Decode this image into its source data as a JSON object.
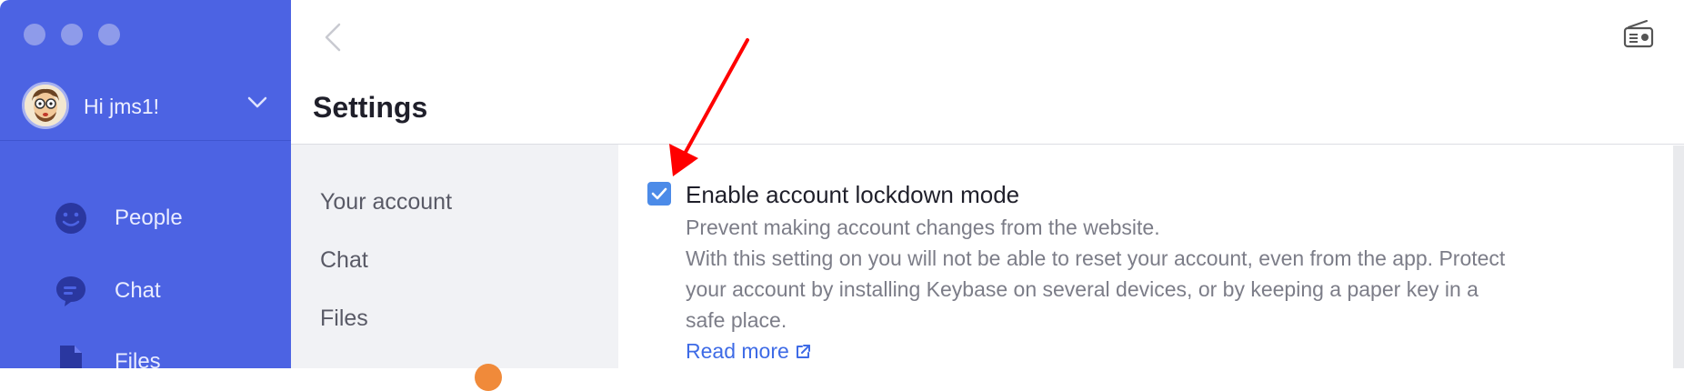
{
  "sidebar": {
    "user_greeting": "Hi jms1!",
    "nav": [
      {
        "label": "People",
        "icon": "people-icon"
      },
      {
        "label": "Chat",
        "icon": "chat-icon"
      },
      {
        "label": "Files",
        "icon": "files-icon"
      }
    ]
  },
  "header": {
    "title": "Settings"
  },
  "settings_nav": {
    "items": [
      "Your account",
      "Chat",
      "Files"
    ]
  },
  "setting": {
    "checked": true,
    "label": "Enable account lockdown mode",
    "description_lines": [
      "Prevent making account changes from the website.",
      "With this setting on you will not be able to reset your account, even from the app. Protect",
      "your account by installing Keybase on several devices, or by keeping a paper key in a",
      "safe place."
    ],
    "read_more": "Read more"
  },
  "colors": {
    "sidebar_bg": "#4c63e3",
    "accent": "#4c8be8",
    "link": "#3e6be6",
    "annotation_arrow": "#ff0000"
  }
}
